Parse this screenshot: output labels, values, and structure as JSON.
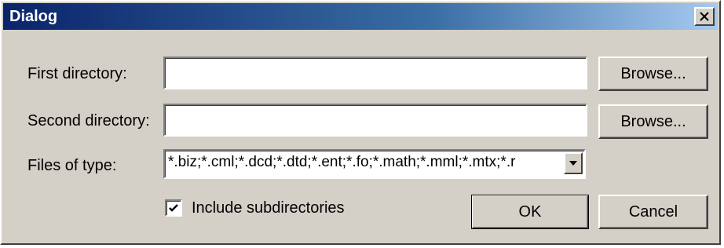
{
  "window": {
    "title": "Dialog"
  },
  "icons": {
    "close": "close-icon",
    "dropdown": "chevron-down-icon",
    "check": "checkmark-icon"
  },
  "fields": {
    "first_directory": {
      "label": "First directory:",
      "value": "",
      "browse_label": "Browse..."
    },
    "second_directory": {
      "label": "Second directory:",
      "value": "",
      "browse_label": "Browse..."
    },
    "files_of_type": {
      "label": "Files of type:",
      "value": "*.biz;*.cml;*.dcd;*.dtd;*.ent;*.fo;*.math;*.mml;*.mtx;*.r"
    }
  },
  "options": {
    "include_subdirectories": {
      "label": "Include subdirectories",
      "checked": true
    }
  },
  "buttons": {
    "ok": "OK",
    "cancel": "Cancel"
  },
  "colors": {
    "title_gradient_start": "#0a246a",
    "title_gradient_end": "#a6caf0",
    "face": "#d4d0c8"
  }
}
